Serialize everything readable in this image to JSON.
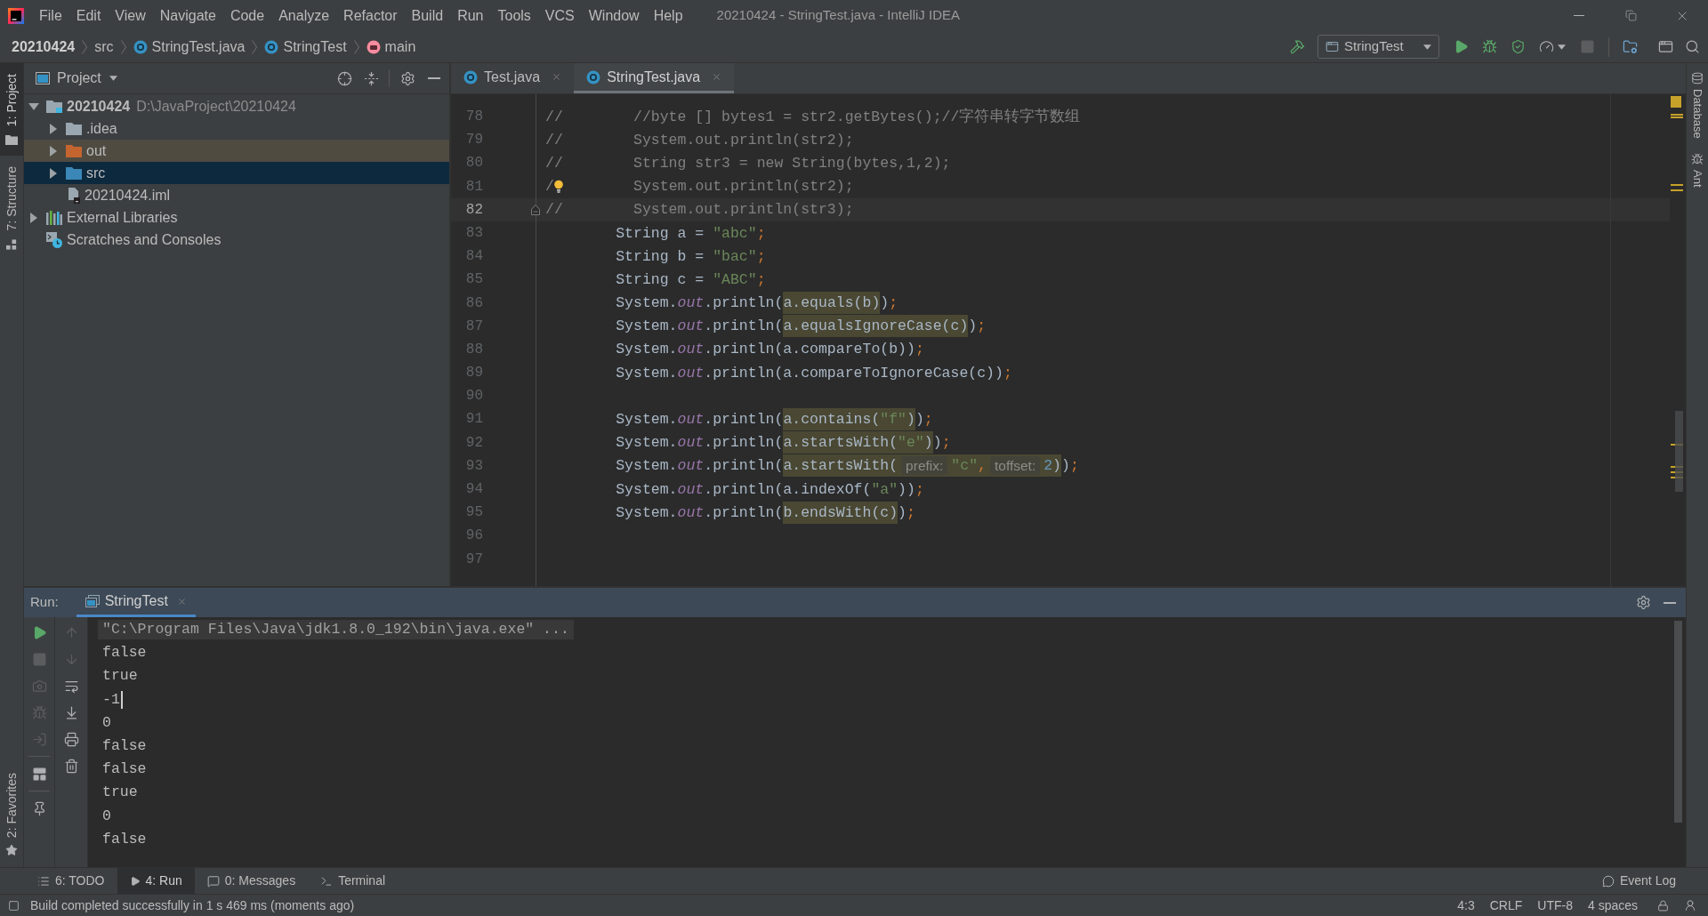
{
  "window": {
    "title": "20210424 - StringTest.java - IntelliJ IDEA"
  },
  "menu": [
    "File",
    "Edit",
    "View",
    "Navigate",
    "Code",
    "Analyze",
    "Refactor",
    "Build",
    "Run",
    "Tools",
    "VCS",
    "Window",
    "Help"
  ],
  "breadcrumbs": [
    {
      "label": "20210424",
      "kind": "project"
    },
    {
      "label": "src",
      "kind": "folder"
    },
    {
      "label": "StringTest.java",
      "kind": "class-file"
    },
    {
      "label": "StringTest",
      "kind": "class"
    },
    {
      "label": "main",
      "kind": "method"
    }
  ],
  "toolbar": {
    "run_config": "StringTest",
    "buttons": [
      {
        "kind": "run",
        "disabled": false
      },
      {
        "kind": "debug",
        "disabled": false
      },
      {
        "kind": "coverage",
        "disabled": false
      },
      {
        "kind": "profile",
        "disabled": false
      },
      {
        "kind": "stop",
        "disabled": true
      }
    ]
  },
  "left_strip": [
    {
      "label": "1: Project",
      "kind": "project",
      "selected": true
    },
    {
      "label": "7: Structure",
      "kind": "structure",
      "selected": false
    }
  ],
  "favorites": {
    "label": "2: Favorites",
    "selected": false
  },
  "right_strip": [
    {
      "label": "Database",
      "kind": "database"
    },
    {
      "label": "Ant",
      "kind": "ant"
    }
  ],
  "project_panel": {
    "title": "Project",
    "tree": [
      {
        "label": "20210424",
        "path": "D:\\JavaProject\\20210424",
        "kind": "module",
        "expanded": true,
        "selected": false,
        "children": [
          {
            "label": ".idea",
            "kind": "folder",
            "expanded": false,
            "selected": false
          },
          {
            "label": "out",
            "kind": "excluded-folder",
            "expanded": false,
            "selected": false
          },
          {
            "label": "src",
            "kind": "source-folder",
            "expanded": false,
            "selected": true
          },
          {
            "label": "20210424.iml",
            "kind": "module-file",
            "selected": false
          }
        ]
      },
      {
        "label": "External Libraries",
        "kind": "libraries",
        "expanded": false,
        "selected": false
      },
      {
        "label": "Scratches and Consoles",
        "kind": "scratches",
        "selected": false
      }
    ]
  },
  "editor": {
    "tabs": [
      {
        "label": "Test.java",
        "selected": false
      },
      {
        "label": "StringTest.java",
        "selected": true
      }
    ],
    "lines": [
      {
        "number": "78",
        "current": false,
        "tokens": [
          {
            "kind": "comment",
            "text": "//        //byte [] bytes1 = str2.getBytes();//字符串转字节数组"
          }
        ]
      },
      {
        "number": "79",
        "current": false,
        "tokens": [
          {
            "kind": "comment",
            "text": "//        System.out.println(str2);"
          }
        ]
      },
      {
        "number": "80",
        "current": false,
        "tokens": [
          {
            "kind": "comment",
            "text": "//        String str3 = new String(bytes,1,2);"
          }
        ]
      },
      {
        "number": "81",
        "current": false,
        "tokens": [
          {
            "kind": "comment",
            "text": "/"
          },
          {
            "kind": "bulb"
          },
          {
            "kind": "comment",
            "text": "        System.out.println(str2);"
          }
        ]
      },
      {
        "number": "82",
        "current": true,
        "fold_marker": true,
        "tokens": [
          {
            "kind": "comment",
            "text": "//        System.out.println(str3);"
          }
        ]
      },
      {
        "number": "83",
        "current": false,
        "tokens": [
          {
            "kind": "plain",
            "text": "        String a = "
          },
          {
            "kind": "string",
            "text": "\"abc\""
          },
          {
            "kind": "keyword",
            "text": ";"
          }
        ]
      },
      {
        "number": "84",
        "current": false,
        "tokens": [
          {
            "kind": "plain",
            "text": "        String b = "
          },
          {
            "kind": "string",
            "text": "\"bac\""
          },
          {
            "kind": "keyword",
            "text": ";"
          }
        ]
      },
      {
        "number": "85",
        "current": false,
        "tokens": [
          {
            "kind": "plain",
            "text": "        String c = "
          },
          {
            "kind": "string",
            "text": "\"ABC\""
          },
          {
            "kind": "keyword",
            "text": ";"
          }
        ]
      },
      {
        "number": "86",
        "current": false,
        "tokens": [
          {
            "kind": "plain",
            "text": "        System."
          },
          {
            "kind": "field",
            "text": "out"
          },
          {
            "kind": "plain",
            "text": ".println("
          },
          {
            "kind": "highlight",
            "tokens": [
              {
                "kind": "plain",
                "text": "a.equals(b)"
              }
            ]
          },
          {
            "kind": "plain",
            "text": ")"
          },
          {
            "kind": "keyword",
            "text": ";"
          }
        ]
      },
      {
        "number": "87",
        "current": false,
        "tokens": [
          {
            "kind": "plain",
            "text": "        System."
          },
          {
            "kind": "field",
            "text": "out"
          },
          {
            "kind": "plain",
            "text": ".println("
          },
          {
            "kind": "highlight",
            "tokens": [
              {
                "kind": "plain",
                "text": "a.equalsIgnoreCase(c)"
              }
            ]
          },
          {
            "kind": "plain",
            "text": ")"
          },
          {
            "kind": "keyword",
            "text": ";"
          }
        ]
      },
      {
        "number": "88",
        "current": false,
        "tokens": [
          {
            "kind": "plain",
            "text": "        System."
          },
          {
            "kind": "field",
            "text": "out"
          },
          {
            "kind": "plain",
            "text": ".println(a.compareTo(b))"
          },
          {
            "kind": "keyword",
            "text": ";"
          }
        ]
      },
      {
        "number": "89",
        "current": false,
        "tokens": [
          {
            "kind": "plain",
            "text": "        System."
          },
          {
            "kind": "field",
            "text": "out"
          },
          {
            "kind": "plain",
            "text": ".println(a.compareToIgnoreCase(c))"
          },
          {
            "kind": "keyword",
            "text": ";"
          }
        ]
      },
      {
        "number": "90",
        "current": false
      },
      {
        "number": "91",
        "current": false,
        "tokens": [
          {
            "kind": "plain",
            "text": "        System."
          },
          {
            "kind": "field",
            "text": "out"
          },
          {
            "kind": "plain",
            "text": ".println("
          },
          {
            "kind": "highlight",
            "tokens": [
              {
                "kind": "plain",
                "text": "a.contains("
              },
              {
                "kind": "string",
                "text": "\"f\""
              },
              {
                "kind": "plain",
                "text": ")"
              }
            ]
          },
          {
            "kind": "plain",
            "text": ")"
          },
          {
            "kind": "keyword",
            "text": ";"
          }
        ]
      },
      {
        "number": "92",
        "current": false,
        "tokens": [
          {
            "kind": "plain",
            "text": "        System."
          },
          {
            "kind": "field",
            "text": "out"
          },
          {
            "kind": "plain",
            "text": ".println("
          },
          {
            "kind": "highlight",
            "tokens": [
              {
                "kind": "plain",
                "text": "a.startsWith("
              },
              {
                "kind": "string",
                "text": "\"e\""
              },
              {
                "kind": "plain",
                "text": ")"
              }
            ]
          },
          {
            "kind": "plain",
            "text": ")"
          },
          {
            "kind": "keyword",
            "text": ";"
          }
        ]
      },
      {
        "number": "93",
        "current": false,
        "tokens": [
          {
            "kind": "plain",
            "text": "        System."
          },
          {
            "kind": "field",
            "text": "out"
          },
          {
            "kind": "plain",
            "text": ".println("
          },
          {
            "kind": "highlight",
            "tokens": [
              {
                "kind": "plain",
                "text": "a.startsWith("
              },
              {
                "kind": "hint",
                "text": "prefix:"
              },
              {
                "kind": "string",
                "text": "\"c\""
              },
              {
                "kind": "keyword",
                "text": ","
              },
              {
                "kind": "hint",
                "text": "toffset:"
              },
              {
                "kind": "number",
                "text": "2"
              },
              {
                "kind": "plain",
                "text": ")"
              }
            ]
          },
          {
            "kind": "plain",
            "text": ")"
          },
          {
            "kind": "keyword",
            "text": ";"
          }
        ]
      },
      {
        "number": "94",
        "current": false,
        "tokens": [
          {
            "kind": "plain",
            "text": "        System."
          },
          {
            "kind": "field",
            "text": "out"
          },
          {
            "kind": "plain",
            "text": ".println(a.indexOf("
          },
          {
            "kind": "string",
            "text": "\"a\""
          },
          {
            "kind": "plain",
            "text": "))"
          },
          {
            "kind": "keyword",
            "text": ";"
          }
        ]
      },
      {
        "number": "95",
        "current": false,
        "tokens": [
          {
            "kind": "plain",
            "text": "        System."
          },
          {
            "kind": "field",
            "text": "out"
          },
          {
            "kind": "plain",
            "text": ".println("
          },
          {
            "kind": "highlight",
            "tokens": [
              {
                "kind": "plain",
                "text": "b.endsWith(c)"
              }
            ]
          },
          {
            "kind": "plain",
            "text": ")"
          },
          {
            "kind": "keyword",
            "text": ";"
          }
        ]
      },
      {
        "number": "96",
        "current": false
      },
      {
        "number": "97",
        "current": false
      }
    ]
  },
  "run_panel": {
    "label": "Run:",
    "tabs": [
      {
        "label": "StringTest",
        "selected": true
      }
    ],
    "toolbar_left": [
      {
        "kind": "rerun",
        "disabled": false
      },
      {
        "kind": "stop",
        "disabled": true
      },
      {
        "kind": "dump-threads",
        "disabled": true
      },
      {
        "kind": "debug",
        "disabled": true
      },
      {
        "kind": "exit",
        "disabled": true
      },
      {
        "kind": "layout",
        "disabled": false
      },
      {
        "kind": "pin",
        "disabled": false
      }
    ],
    "toolbar_right": [
      {
        "kind": "up",
        "disabled": true
      },
      {
        "kind": "down",
        "disabled": true
      },
      {
        "kind": "soft-wrap",
        "disabled": false
      },
      {
        "kind": "scroll-end",
        "disabled": false
      },
      {
        "kind": "print",
        "disabled": false
      },
      {
        "kind": "clear",
        "disabled": false
      }
    ],
    "console": [
      {
        "kind": "command",
        "text": "\"C:\\Program Files\\Java\\jdk1.8.0_192\\bin\\java.exe\" ...",
        "caret": false
      },
      {
        "kind": "output",
        "text": "false",
        "caret": false
      },
      {
        "kind": "output",
        "text": "true",
        "caret": false
      },
      {
        "kind": "output",
        "text": "-1",
        "caret": true
      },
      {
        "kind": "output",
        "text": "0",
        "caret": false
      },
      {
        "kind": "output",
        "text": "false",
        "caret": false
      },
      {
        "kind": "output",
        "text": "false",
        "caret": false
      },
      {
        "kind": "output",
        "text": "true",
        "caret": false
      },
      {
        "kind": "output",
        "text": "0",
        "caret": false
      },
      {
        "kind": "output",
        "text": "false",
        "caret": false
      }
    ]
  },
  "tool_windows": [
    {
      "label": "6: TODO",
      "kind": "todo",
      "selected": false
    },
    {
      "label": "4: Run",
      "kind": "run",
      "selected": true
    },
    {
      "label": "0: Messages",
      "kind": "messages",
      "selected": false
    },
    {
      "label": "Terminal",
      "kind": "terminal",
      "selected": false
    }
  ],
  "event_log": "Event Log",
  "status_bar": {
    "message": "Build completed successfully in 1 s 469 ms (moments ago)",
    "items": [
      "4:3",
      "CRLF",
      "UTF-8",
      "4 spaces"
    ]
  }
}
